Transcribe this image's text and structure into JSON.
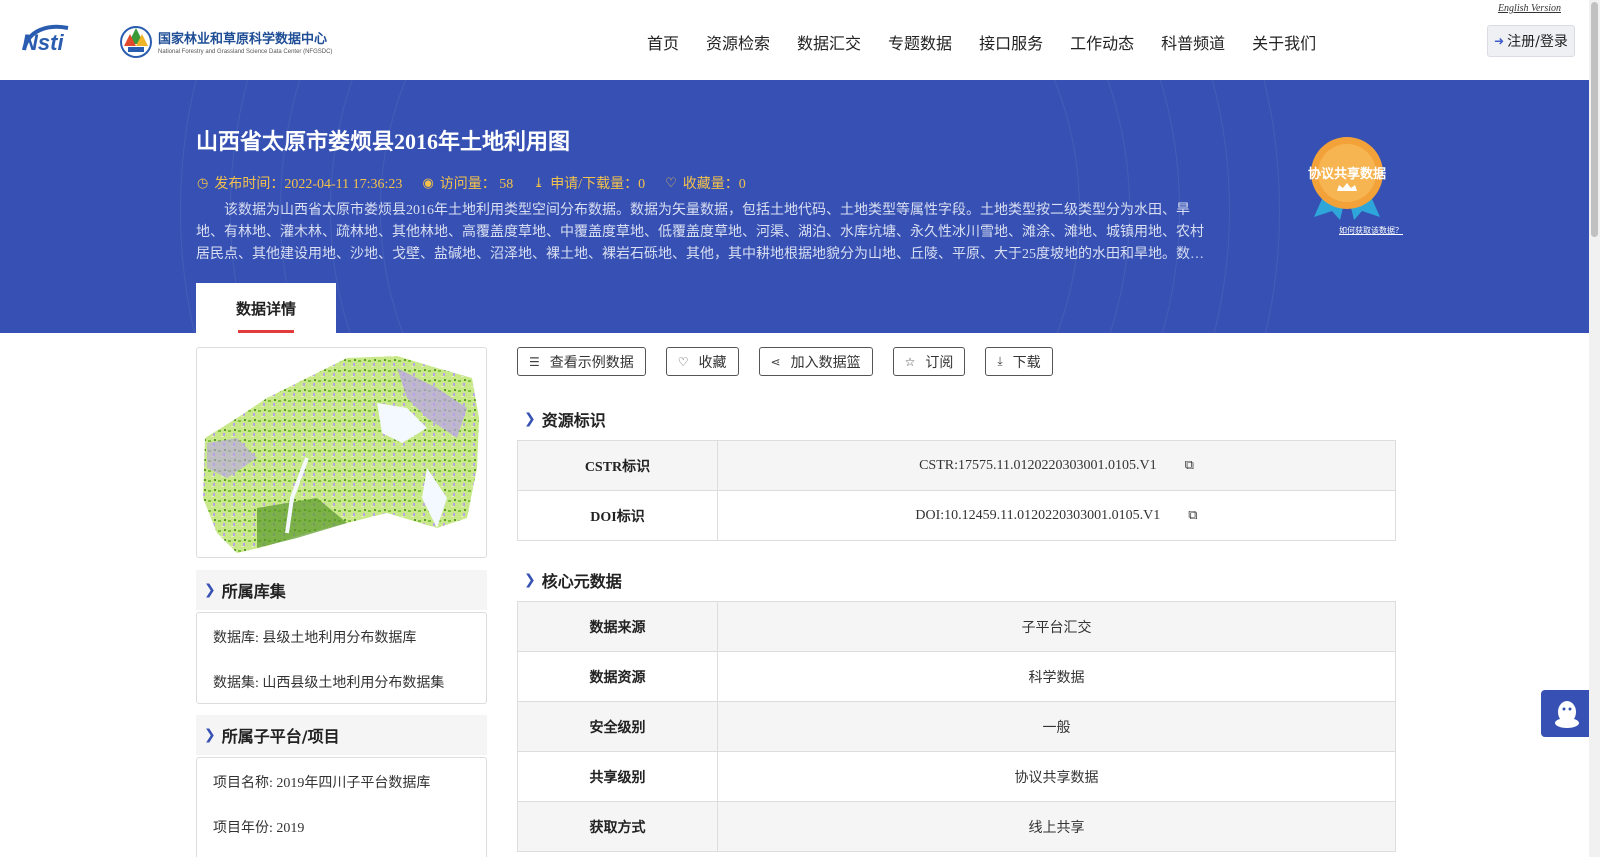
{
  "header": {
    "logo_nsti_alt": "Nsti",
    "logo_cn": "国家林业和草原科学数据中心",
    "logo_en": "National Forestry and Grassland Science Data Center (NFGSDC)",
    "nav": [
      "首页",
      "资源检索",
      "数据汇交",
      "专题数据",
      "接口服务",
      "工作动态",
      "科普频道",
      "关于我们"
    ],
    "english_version": "English Version",
    "login": "注册/登录"
  },
  "banner": {
    "title": "山西省太原市娄烦县2016年土地利用图",
    "publish_time": "发布时间：2022-04-11 17:36:23",
    "views": "访问量： 58",
    "downloads": "申请/下载量：0",
    "favorites": "收藏量：0",
    "description": "该数据为山西省太原市娄烦县2016年土地利用类型空间分布数据。数据为矢量数据，包括土地代码、土地类型等属性字段。土地类型按二级类型分为水田、旱地、有林地、灌木林、疏林地、其他林地、高覆盖度草地、中覆盖度草地、低覆盖度草地、河渠、湖泊、水库坑塘、永久性冰川雪地、滩涂、滩地、城镇用地、农村居民点、其他建设用地、沙地、戈壁、盐碱地、沼泽地、裸土地、裸岩石砾地、其他，其中耕地根据地貌分为山地、丘陵、平原、大于25度坡地的水田和旱地。数…",
    "badge_label": "协议共享数据",
    "badge_link": "如何获取该数据？",
    "tab": "数据详情"
  },
  "left": {
    "library_title": "所属库集",
    "database": "数据库: 县级土地利用分布数据库",
    "dataset": "数据集: 山西县级土地利用分布数据集",
    "platform_title": "所属子平台/项目",
    "project_name": "项目名称: 2019年四川子平台数据库",
    "project_year": "项目年份: 2019"
  },
  "actions": [
    "查看示例数据",
    "收藏",
    "加入数据篮",
    "订阅",
    "下载"
  ],
  "resource_id": {
    "title": "资源标识",
    "rows": [
      {
        "key": "CSTR标识",
        "value": "CSTR:17575.11.0120220303001.0105.V1"
      },
      {
        "key": "DOI标识",
        "value": "DOI:10.12459.11.0120220303001.0105.V1"
      }
    ]
  },
  "core_meta": {
    "title": "核心元数据",
    "rows": [
      {
        "key": "数据来源",
        "value": "子平台汇交"
      },
      {
        "key": "数据资源",
        "value": "科学数据"
      },
      {
        "key": "安全级别",
        "value": "一般"
      },
      {
        "key": "共享级别",
        "value": "协议共享数据"
      },
      {
        "key": "获取方式",
        "value": "线上共享"
      }
    ]
  },
  "colors": {
    "banner": "#3651b3",
    "meta": "#f3c14c",
    "accent": "#e23b3b"
  }
}
